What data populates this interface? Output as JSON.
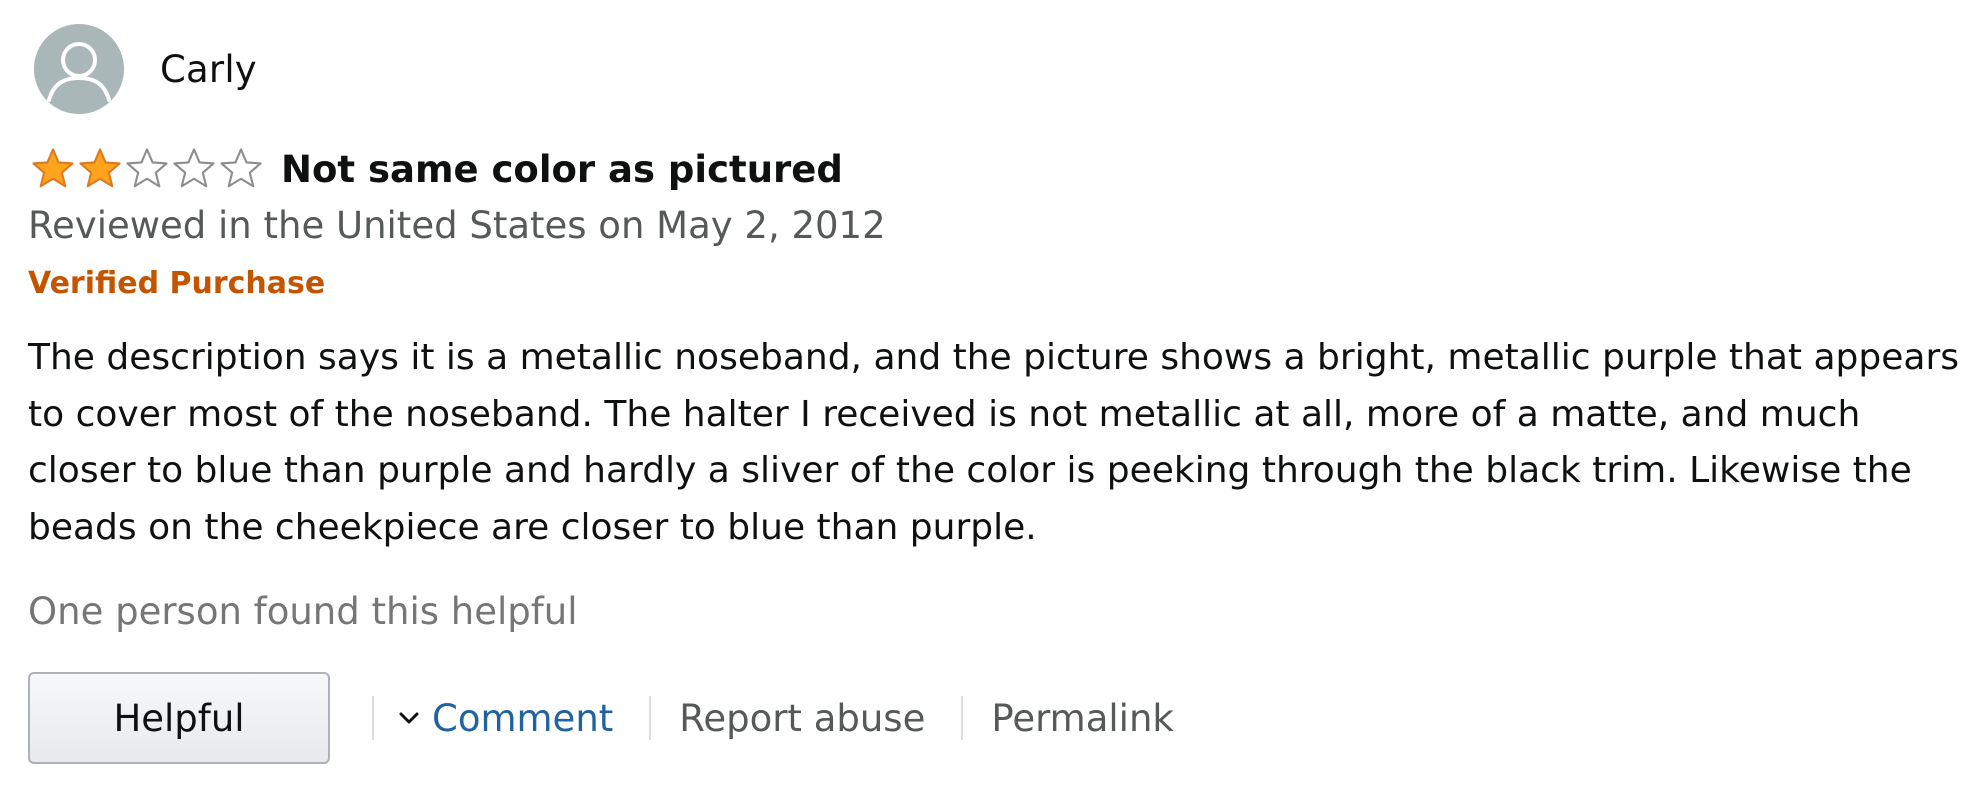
{
  "review": {
    "profile": {
      "name": "Carly",
      "avatar_icon": "default-user-avatar-icon"
    },
    "rating": {
      "stars": 2,
      "max_stars": 5,
      "filled_color": "#ffa41c",
      "outline_color": "#de7921"
    },
    "title": "Not same color as pictured",
    "date_line": "Reviewed in the United States on May 2, 2012",
    "badge": "Verified Purchase",
    "body": "The description says it is a metallic noseband, and the picture shows a bright, metallic purple that appears to cover most of the noseband. The halter I received is not metallic at all, more of a matte, and much closer to blue than purple and hardly a sliver of the color is peeking through the black trim. Likewise the beads on the cheekpiece are closer to blue than purple.",
    "helpful_count_text": "One person found this helpful",
    "actions": {
      "helpful_label": "Helpful",
      "comment_label": "Comment",
      "report_label": "Report abuse",
      "permalink_label": "Permalink"
    },
    "colors": {
      "badge": "#c45500",
      "link": "#2162a1",
      "muted": "#565959"
    }
  }
}
